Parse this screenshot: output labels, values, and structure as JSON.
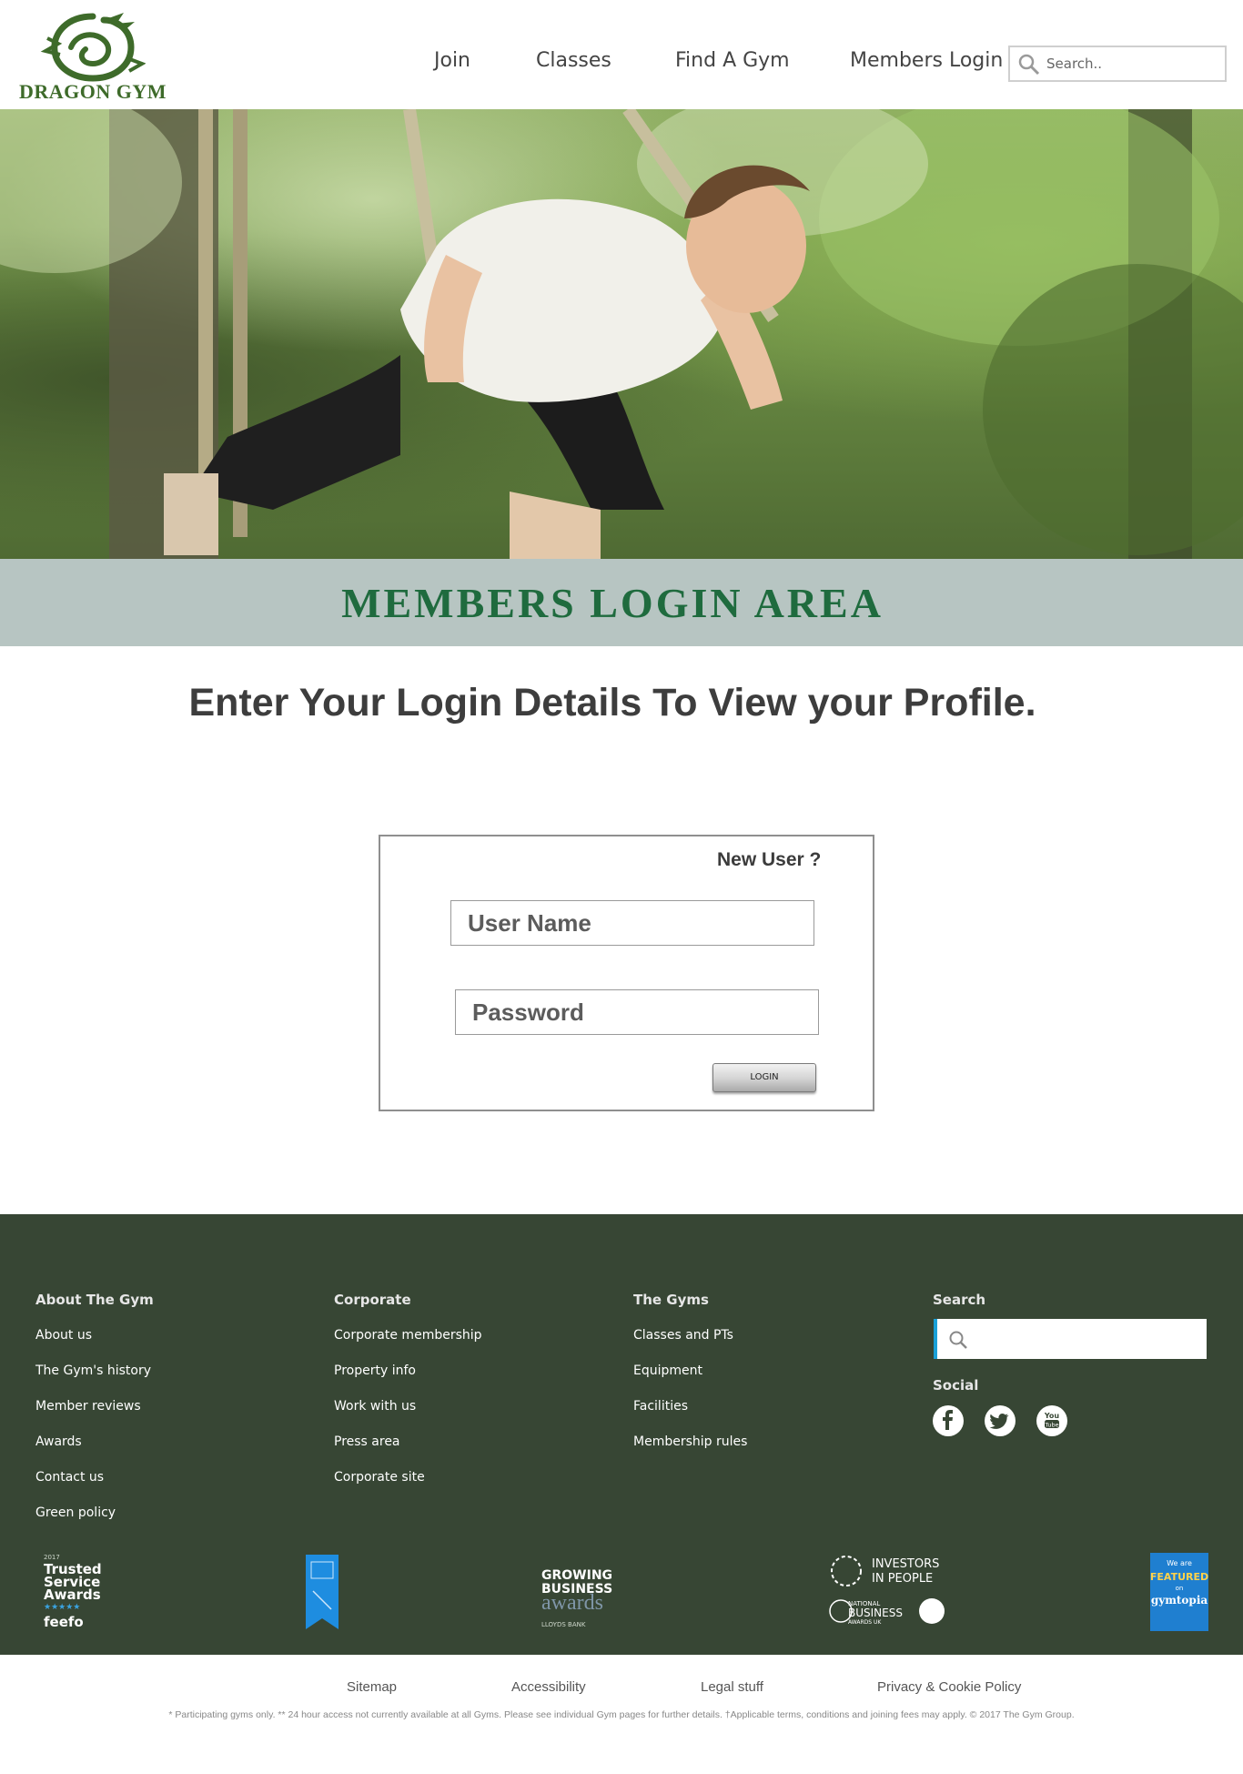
{
  "brand": {
    "name": "DRAGON GYM",
    "green": "#3e6b2a"
  },
  "nav": {
    "items": [
      "Join",
      "Classes",
      "Find A Gym",
      "Members Login"
    ]
  },
  "search": {
    "placeholder": "Search.."
  },
  "band": {
    "title": "MEMBERS LOGIN AREA",
    "background": "#b7c5c2",
    "title_color": "#1f6b3e"
  },
  "main": {
    "subtitle": "Enter Your Login Details To View your Profile."
  },
  "login": {
    "new_user_label": "New User ?",
    "username_placeholder": "User Name",
    "password_placeholder": "Password",
    "login_button_label": "LOGIN"
  },
  "footer": {
    "background": "#374634",
    "columns": [
      {
        "heading": "About The Gym",
        "links": [
          "About us",
          "The Gym's history",
          "Member reviews",
          "Awards",
          "Contact us",
          "Green policy"
        ]
      },
      {
        "heading": "Corporate",
        "links": [
          "Corporate membership",
          "Property info",
          "Work with us",
          "Press area",
          "Corporate site"
        ]
      },
      {
        "heading": "The Gyms",
        "links": [
          "Classes and PTs",
          "Equipment",
          "Facilities",
          "Membership rules"
        ]
      }
    ],
    "search_heading": "Search",
    "social_heading": "Social",
    "social_icons": [
      "facebook-icon",
      "twitter-icon",
      "youtube-icon"
    ],
    "awards": {
      "feefo": {
        "year": "2017",
        "line1": "Trusted",
        "line2": "Service",
        "line3": "Awards",
        "brand": "feefo"
      },
      "growing": {
        "line1": "GROWING",
        "line2": "BUSINESS",
        "line3": "awards",
        "sponsor": "LLOYDS BANK"
      },
      "investors": {
        "line1": "INVESTORS",
        "line2": "IN PEOPLE",
        "nb1": "NATIONAL",
        "nb2": "BUSINESS",
        "nb3": "AWARDS UK"
      },
      "gymtopia": {
        "line1": "We are",
        "line2": "FEATURED",
        "line3": "on",
        "line4": "gymtopia"
      }
    }
  },
  "bottom": {
    "links": [
      "Sitemap",
      "Accessibility",
      "Legal stuff",
      "Privacy & Cookie Policy"
    ],
    "fine_print": "* Participating gyms only. ** 24 hour access not currently available at all Gyms. Please see individual Gym pages for further details. †Applicable terms, conditions and joining fees may apply. © 2017 The Gym Group."
  }
}
